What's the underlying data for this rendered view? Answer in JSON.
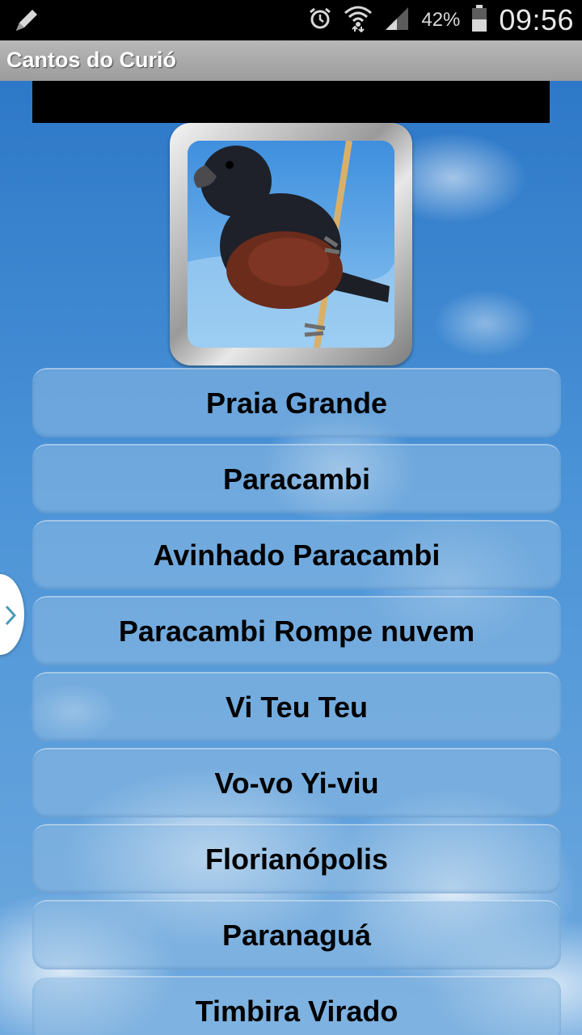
{
  "status_bar": {
    "battery_percent": "42%",
    "time": "09:56",
    "icons": [
      "pencil-icon",
      "alarm-icon",
      "wifi-icon",
      "signal-icon",
      "battery-icon"
    ]
  },
  "app": {
    "title": "Cantos do Curió"
  },
  "songs": [
    {
      "label": "Praia Grande"
    },
    {
      "label": "Paracambi"
    },
    {
      "label": "Avinhado Paracambi"
    },
    {
      "label": "Paracambi Rompe nuvem"
    },
    {
      "label": "Vi Teu Teu"
    },
    {
      "label": "Vo-vo Yi-viu"
    },
    {
      "label": "Florianópolis"
    },
    {
      "label": "Paranaguá"
    },
    {
      "label": "Timbira Virado"
    }
  ],
  "side_handle": {
    "icon": "chevron-right-icon"
  },
  "colors": {
    "sky": "#3f87cf",
    "title_bar": "#a9a9a9",
    "handle_chevron": "#4a9bb5"
  }
}
